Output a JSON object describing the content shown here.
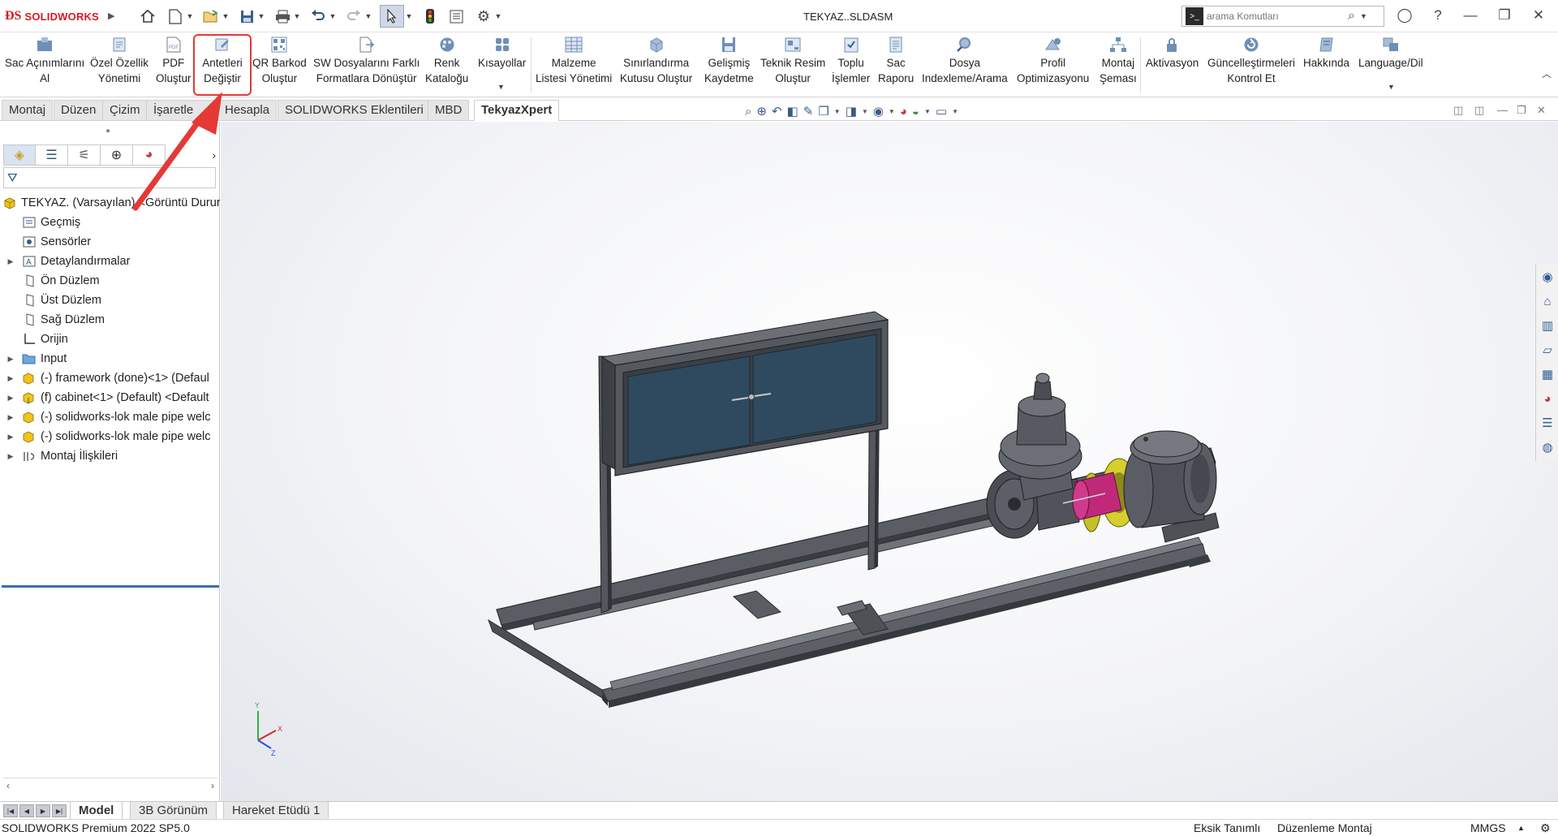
{
  "app": {
    "brand": "SOLIDWORKS",
    "document_title": "TEKYAZ..SLDASM",
    "accent_color": "#d71920"
  },
  "quick_access": {
    "icons": [
      "home-icon",
      "new-document-icon",
      "open-icon",
      "save-icon",
      "print-icon",
      "undo-icon",
      "redo-icon",
      "select-cursor-icon",
      "rebuild-traffic-light-icon",
      "file-properties-icon",
      "options-gear-icon"
    ]
  },
  "search": {
    "placeholder": "arama Komutları"
  },
  "ribbon": {
    "buttons": [
      {
        "label1": "Sac Açınımlarını",
        "label2": "Al"
      },
      {
        "label1": "Özel Özellik",
        "label2": "Yönetimi"
      },
      {
        "label1": "PDF",
        "label2": "Oluştur"
      },
      {
        "label1": "Antetleri",
        "label2": "Değiştir"
      },
      {
        "label1": "QR Barkod",
        "label2": "Oluştur"
      },
      {
        "label1": "SW Dosyalarını Farklı",
        "label2": "Formatlara Dönüştür"
      },
      {
        "label1": "Renk",
        "label2": "Kataloğu"
      },
      {
        "label1": "Kısayollar",
        "label2": ""
      },
      {
        "label1": "Malzeme",
        "label2": "Listesi Yönetimi"
      },
      {
        "label1": "Sınırlandırma",
        "label2": "Kutusu Oluştur"
      },
      {
        "label1": "Gelişmiş",
        "label2": "Kaydetme"
      },
      {
        "label1": "Teknik Resim",
        "label2": "Oluştur"
      },
      {
        "label1": "Toplu",
        "label2": "İşlemler"
      },
      {
        "label1": "Sac",
        "label2": "Raporu"
      },
      {
        "label1": "Dosya",
        "label2": "Indexleme/Arama"
      },
      {
        "label1": "Profil",
        "label2": "Optimizasyonu"
      },
      {
        "label1": "Montaj",
        "label2": "Şeması"
      },
      {
        "label1": "Aktivasyon",
        "label2": ""
      },
      {
        "label1": "Güncelleştirmeleri",
        "label2": "Kontrol Et"
      },
      {
        "label1": "Hakkında",
        "label2": ""
      },
      {
        "label1": "Language/Dil",
        "label2": ""
      }
    ],
    "highlighted": "Antetleri Değiştir",
    "highlight_color": "#e53935"
  },
  "command_tabs": [
    "Montaj",
    "Düzen",
    "Çizim",
    "İşaretle",
    "Hesapla",
    "SOLIDWORKS Eklentileri",
    "MBD",
    "TekyazXpert"
  ],
  "active_command_tab": "TekyazXpert",
  "feature_tree": {
    "root": "TEKYAZ. (Varsayılan) <Görüntü Durur",
    "items": [
      {
        "label": "Geçmiş"
      },
      {
        "label": "Sensörler"
      },
      {
        "label": "Detaylandırmalar"
      },
      {
        "label": "Ön Düzlem"
      },
      {
        "label": "Üst Düzlem"
      },
      {
        "label": "Sağ Düzlem"
      },
      {
        "label": "Orijin"
      },
      {
        "label": "Input"
      },
      {
        "label": "(-) framework (done)<1> (Defaul"
      },
      {
        "label": "(f) cabinet<1> (Default) <Default"
      },
      {
        "label": "(-) solidworks-lok male pipe welc"
      },
      {
        "label": "(-) solidworks-lok male pipe welc"
      },
      {
        "label": "Montaj İlişkileri"
      }
    ]
  },
  "triad": {
    "x": "X",
    "y": "Y",
    "z": "Z"
  },
  "bottom_tabs": [
    "Model",
    "3B Görünüm",
    "Hareket Etüdü 1"
  ],
  "active_bottom_tab": "Model",
  "status": {
    "product": "SOLIDWORKS Premium 2022 SP5.0",
    "definition": "Eksik Tanımlı",
    "mode": "Düzenleme Montaj",
    "units": "MMGS"
  }
}
